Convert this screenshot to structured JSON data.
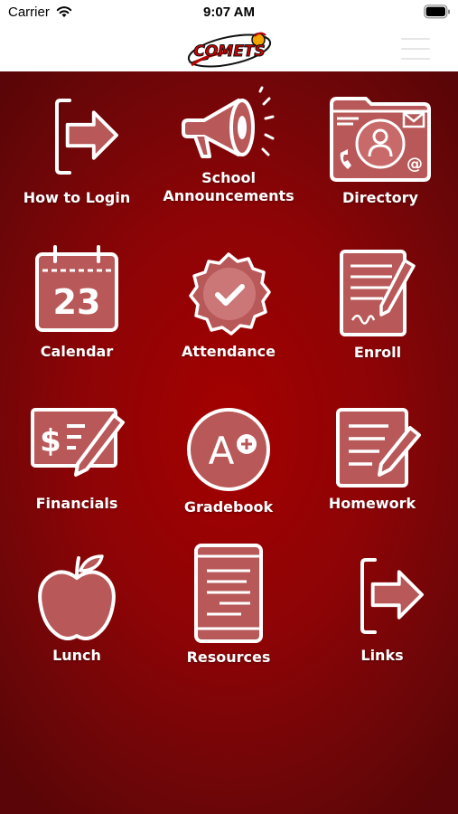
{
  "status_bar": {
    "carrier": "Carrier",
    "time": "9:07 AM"
  },
  "header": {
    "logo_text": "COMETS",
    "menu_icon": "hamburger-menu-icon"
  },
  "tiles": [
    {
      "label": "How to Login",
      "icon": "login-arrow-icon"
    },
    {
      "label": "School Announcements",
      "line1": "School",
      "line2": "Announcements",
      "icon": "megaphone-icon"
    },
    {
      "label": "Directory",
      "icon": "contact-card-icon"
    },
    {
      "label": "Calendar",
      "icon": "calendar-icon",
      "calendar_day": "23"
    },
    {
      "label": "Attendance",
      "icon": "checkmark-badge-icon"
    },
    {
      "label": "Enroll",
      "icon": "signature-document-icon"
    },
    {
      "label": "Financials",
      "icon": "check-pen-icon"
    },
    {
      "label": "Gradebook",
      "icon": "grade-a-plus-icon",
      "grade": "A"
    },
    {
      "label": "Homework",
      "icon": "notepad-pencil-icon"
    },
    {
      "label": "Lunch",
      "icon": "apple-icon"
    },
    {
      "label": "Resources",
      "icon": "tablet-document-icon"
    },
    {
      "label": "Links",
      "icon": "links-arrow-icon"
    }
  ],
  "colors": {
    "background_center": "#a40000",
    "background_edge": "#5a0507",
    "icon_fill": "#b85858",
    "text": "#ffffff"
  }
}
